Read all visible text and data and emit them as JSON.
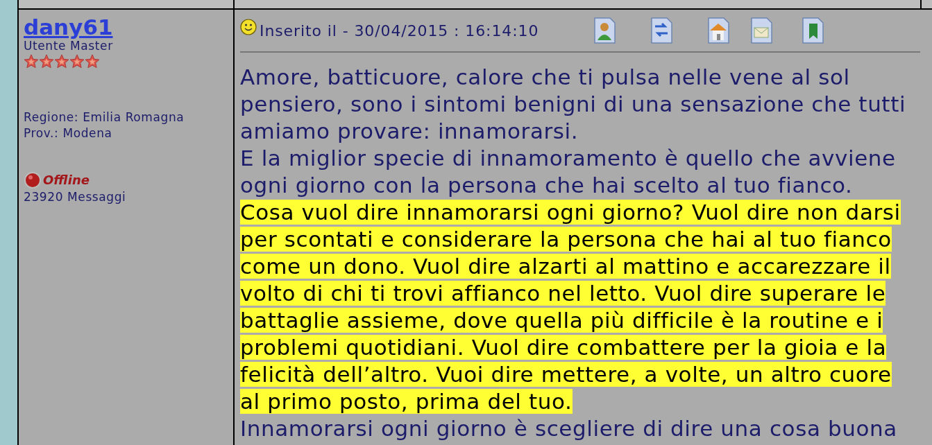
{
  "author": {
    "username": "dany61",
    "rank": "Utente Master",
    "stars": 5,
    "region": "Regione: Emilia Romagna",
    "province": "Prov.: Modena",
    "status": "Offline",
    "online": false,
    "messages": "23920 Messaggi"
  },
  "post": {
    "posted": "Inserito il - 30/04/2015 : 16:14:10",
    "paragraphs": [
      {
        "text": "Amore, batticuore, calore che ti pulsa nelle vene al sol pensiero, sono i sintomi benigni di una sensazione che tutti amiamo provare: innamorarsi.",
        "highlighted": false
      },
      {
        "text": "E la miglior specie di innamoramento è quello che avviene ogni giorno con la persona che hai scelto al tuo fianco.",
        "highlighted": false
      },
      {
        "text": "Cosa vuol dire innamorarsi ogni giorno? Vuol dire non darsi per scontati e considerare la persona che hai al tuo fianco come un dono. Vuol dire alzarti al mattino e accarezzare il volto di chi ti trovi affianco nel letto. Vuol dire superare le battaglie assieme, dove quella più difficile è la routine e i problemi quotidiani. Vuol dire combattere per la gioia e la felicità dell’altro. Vuoi dire mettere, a volte, un altro cuore al primo posto, prima del tuo.",
        "highlighted": true
      },
      {
        "text": "Innamorarsi ogni giorno è scegliere di dire una cosa buona",
        "highlighted": false
      }
    ]
  }
}
